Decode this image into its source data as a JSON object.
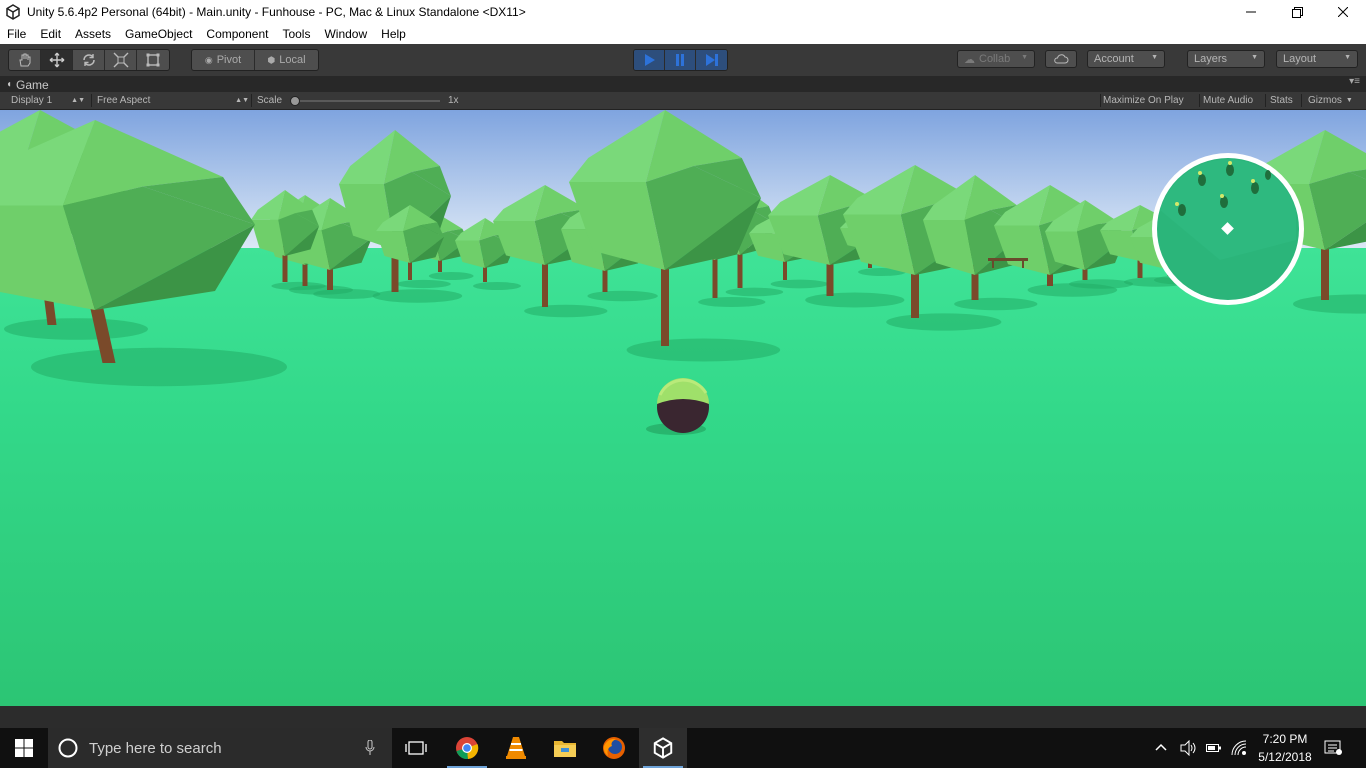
{
  "window": {
    "title": "Unity 5.6.4p2 Personal (64bit) - Main.unity - Funhouse - PC, Mac & Linux Standalone <DX11>"
  },
  "menu": [
    "File",
    "Edit",
    "Assets",
    "GameObject",
    "Component",
    "Tools",
    "Window",
    "Help"
  ],
  "toolbar": {
    "transform_tools": [
      "hand-tool",
      "move-tool",
      "rotate-tool",
      "scale-tool",
      "rect-tool"
    ],
    "pivot_label": "Pivot",
    "local_label": "Local",
    "collab_label": "Collab",
    "account_label": "Account",
    "layers_label": "Layers",
    "layout_label": "Layout",
    "play_state": "playing",
    "accent_color": "#2d72d9"
  },
  "game_view": {
    "tab_label": "Game",
    "display": "Display 1",
    "aspect": "Free Aspect",
    "scale_label": "Scale",
    "scale_value": "1x",
    "maximize_on_play": "Maximize On Play",
    "mute_audio": "Mute Audio",
    "stats": "Stats",
    "gizmos": "Gizmos"
  },
  "scene": {
    "sky_color": "#7fa4df",
    "ground_color": "#2fd27f",
    "tree_foliage": "#6fcf6a",
    "tree_trunk": "#7a4a2a",
    "ball_top": "#9fe06a",
    "ball_bottom": "#3a2630"
  },
  "taskbar": {
    "search_placeholder": "Type here to search",
    "apps": [
      "task-view-icon",
      "chrome-icon",
      "vlc-icon",
      "file-explorer-icon",
      "firefox-icon",
      "unity-icon"
    ],
    "time": "7:20 PM",
    "date": "5/12/2018"
  }
}
